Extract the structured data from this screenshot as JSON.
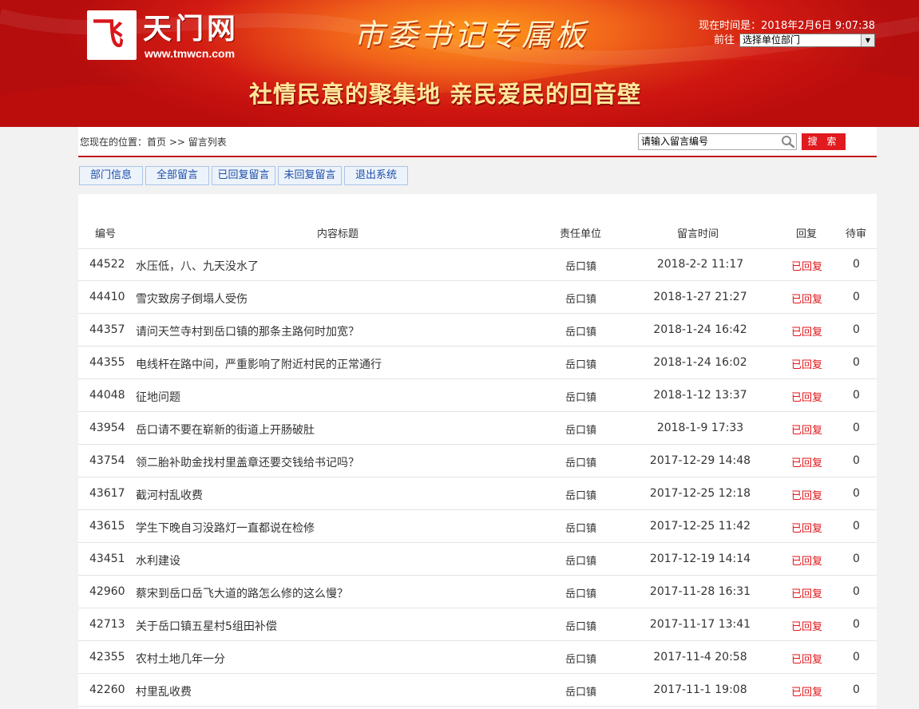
{
  "header": {
    "logo_mark": "飞",
    "logo_name": "天门网",
    "logo_url": "www.tmwcn.com",
    "calligraphy": "市委书记专属板",
    "slogan": "社情民意的聚集地  亲民爱民的回音壁",
    "time_label": "现在时间是：2018年2月6日 9:07:38",
    "goto_label": "前往",
    "unit_select_value": "选择单位部门"
  },
  "location": {
    "breadcrumb": "您现在的位置：首页 >> 留言列表",
    "search_placeholder": "请输入留言编号",
    "search_button": "搜 索"
  },
  "tabs": [
    {
      "label": "部门信息"
    },
    {
      "label": "全部留言"
    },
    {
      "label": "已回复留言"
    },
    {
      "label": "未回复留言"
    },
    {
      "label": "退出系统"
    }
  ],
  "table": {
    "columns": {
      "id": "编号",
      "title": "内容标题",
      "unit": "责任单位",
      "time": "留言时间",
      "reply": "回复",
      "pending": "待审"
    },
    "rows": [
      {
        "id": "44522",
        "title": "水压低，八、九天没水了",
        "unit": "岳口镇",
        "time": "2018-2-2 11:17",
        "reply": "已回复",
        "pending": "0"
      },
      {
        "id": "44410",
        "title": "雪灾致房子倒塌人受伤",
        "unit": "岳口镇",
        "time": "2018-1-27 21:27",
        "reply": "已回复",
        "pending": "0"
      },
      {
        "id": "44357",
        "title": "请问天竺寺村到岳口镇的那条主路何时加宽？",
        "unit": "岳口镇",
        "time": "2018-1-24 16:42",
        "reply": "已回复",
        "pending": "0"
      },
      {
        "id": "44355",
        "title": "电线杆在路中间，严重影响了附近村民的正常通行",
        "unit": "岳口镇",
        "time": "2018-1-24 16:02",
        "reply": "已回复",
        "pending": "0"
      },
      {
        "id": "44048",
        "title": "征地问题",
        "unit": "岳口镇",
        "time": "2018-1-12 13:37",
        "reply": "已回复",
        "pending": "0"
      },
      {
        "id": "43954",
        "title": "岳口请不要在崭新的街道上开肠破肚",
        "unit": "岳口镇",
        "time": "2018-1-9 17:33",
        "reply": "已回复",
        "pending": "0"
      },
      {
        "id": "43754",
        "title": "领二胎补助金找村里盖章还要交钱给书记吗？",
        "unit": "岳口镇",
        "time": "2017-12-29 14:48",
        "reply": "已回复",
        "pending": "0"
      },
      {
        "id": "43617",
        "title": "截河村乱收费",
        "unit": "岳口镇",
        "time": "2017-12-25 12:18",
        "reply": "已回复",
        "pending": "0"
      },
      {
        "id": "43615",
        "title": "学生下晚自习没路灯一直都说在检修",
        "unit": "岳口镇",
        "time": "2017-12-25 11:42",
        "reply": "已回复",
        "pending": "0"
      },
      {
        "id": "43451",
        "title": "水利建设",
        "unit": "岳口镇",
        "time": "2017-12-19 14:14",
        "reply": "已回复",
        "pending": "0"
      },
      {
        "id": "42960",
        "title": "蔡宋到岳口岳飞大道的路怎么修的这么慢？",
        "unit": "岳口镇",
        "time": "2017-11-28 16:31",
        "reply": "已回复",
        "pending": "0"
      },
      {
        "id": "42713",
        "title": "关于岳口镇五星村5组田补偿",
        "unit": "岳口镇",
        "time": "2017-11-17 13:41",
        "reply": "已回复",
        "pending": "0"
      },
      {
        "id": "42355",
        "title": "农村土地几年一分",
        "unit": "岳口镇",
        "time": "2017-11-4 20:58",
        "reply": "已回复",
        "pending": "0"
      },
      {
        "id": "42260",
        "title": "村里乱收费",
        "unit": "岳口镇",
        "time": "2017-11-1 19:08",
        "reply": "已回复",
        "pending": "0"
      }
    ]
  },
  "colors": {
    "brand_red": "#c2161a",
    "reply_red": "#e0161b",
    "tab_blue": "#1d4fa8"
  }
}
